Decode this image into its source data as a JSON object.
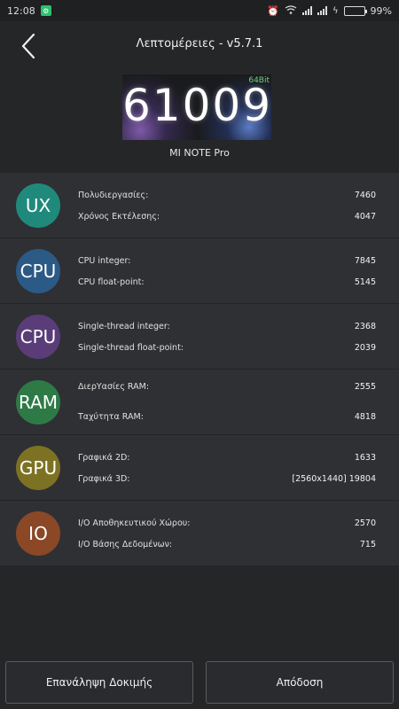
{
  "status_bar": {
    "time": "12:08",
    "battery_text": "99%",
    "icons": [
      "notification-icon",
      "alarm-icon",
      "wifi-icon",
      "signal-icon",
      "signal-icon",
      "charging-icon",
      "battery-icon"
    ],
    "battery_level": 0.99
  },
  "header": {
    "title": "Λεπτομέρειες - v5.7.1"
  },
  "score": {
    "value": "61009",
    "bit_label": "64Bit",
    "device": "MI NOTE Pro"
  },
  "categories": [
    {
      "badge": "UX",
      "color": "#1f8a7c",
      "metrics": [
        {
          "label": "Πολυδιεργασίες:",
          "value": "7460"
        },
        {
          "label": "Χρόνος Εκτέλεσης:",
          "value": "4047"
        }
      ]
    },
    {
      "badge": "CPU",
      "color": "#2c5a86",
      "metrics": [
        {
          "label": "CPU integer:",
          "value": "7845"
        },
        {
          "label": "CPU float-point:",
          "value": "5145"
        }
      ]
    },
    {
      "badge": "CPU",
      "color": "#5a3d78",
      "metrics": [
        {
          "label": "Single-thread integer:",
          "value": "2368"
        },
        {
          "label": "Single-thread float-point:",
          "value": "2039"
        }
      ]
    },
    {
      "badge": "RAM",
      "color": "#2e7a46",
      "metrics": [
        {
          "label": "ΔιερΥασίες RAM:",
          "value": "2555"
        },
        {
          "label": "Ταχύτητα RAM:",
          "value": "4818"
        }
      ]
    },
    {
      "badge": "GPU",
      "color": "#7d7223",
      "metrics": [
        {
          "label": "Γραφικά 2D:",
          "value": "1633"
        },
        {
          "label": "Γραφικά 3D:",
          "value": "[2560x1440] 19804"
        }
      ]
    },
    {
      "badge": "IO",
      "color": "#8a4826",
      "metrics": [
        {
          "label": "I/O Αποθηκευτικού Χώρου:",
          "value": "2570"
        },
        {
          "label": "I/O Βάσης Δεδομένων:",
          "value": "715"
        }
      ]
    }
  ],
  "footer": {
    "retry_label": "Επανάληψη Δοκιμής",
    "performance_label": "Απόδοση"
  }
}
